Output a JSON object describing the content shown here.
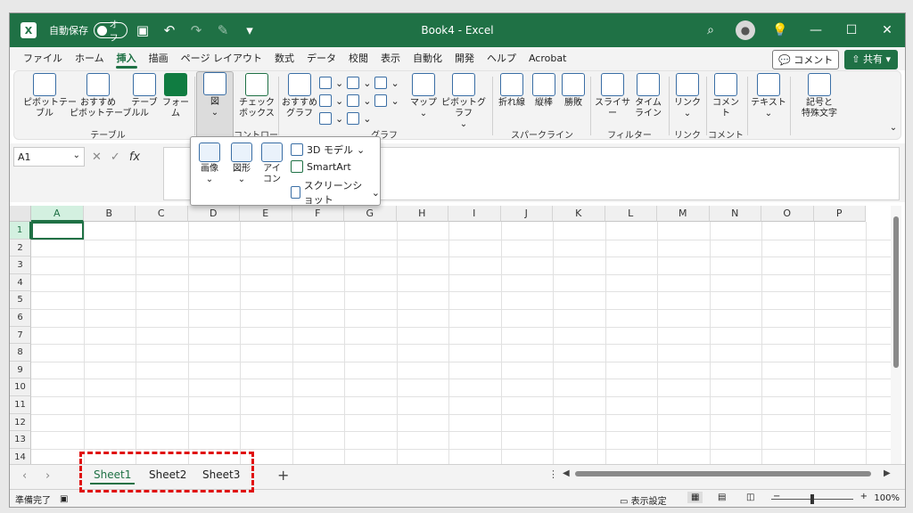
{
  "titlebar": {
    "autosave_label": "自動保存",
    "autosave_state": "オフ",
    "doc_title": "Book4 - Excel"
  },
  "tabs": [
    "ファイル",
    "ホーム",
    "挿入",
    "描画",
    "ページ レイアウト",
    "数式",
    "データ",
    "校閲",
    "表示",
    "自動化",
    "開発",
    "ヘルプ",
    "Acrobat"
  ],
  "active_tab": "挿入",
  "actions": {
    "comment": "コメント",
    "share": "共有"
  },
  "ribbon": {
    "pivot_table": "ピボットテー\nブル",
    "recommended_pivot": "おすすめ\nピボットテーブル",
    "table": "テーブル",
    "forms": "フォー\nム",
    "figure": "図",
    "checkbox": "チェック\nボックス",
    "recommended_charts": "おすすめ\nグラフ",
    "maps": "マップ",
    "pivot_chart": "ピボットグラフ",
    "line_spark": "折れ線",
    "column_spark": "縦棒",
    "winloss_spark": "勝敗",
    "slicer": "スライサー",
    "timeline": "タイム\nライン",
    "link": "リンク",
    "comment": "コメント",
    "text": "テキスト",
    "symbols": "記号と\n特殊文字",
    "groups": {
      "tables": "テーブル",
      "controls": "コントロール",
      "charts": "グラフ",
      "sparklines": "スパークライン",
      "filters": "フィルター",
      "links": "リンク",
      "comments": "コメント"
    }
  },
  "gallery": {
    "image": "画像",
    "shapes": "図形",
    "icons": "アイ\nコン",
    "model3d": "3D モデル",
    "smartart": "SmartArt",
    "screenshot": "スクリーンショット"
  },
  "namebox": "A1",
  "columns": [
    "A",
    "B",
    "C",
    "D",
    "E",
    "F",
    "G",
    "H",
    "I",
    "J",
    "K",
    "L",
    "M",
    "N",
    "O",
    "P"
  ],
  "rows": [
    "1",
    "2",
    "3",
    "4",
    "5",
    "6",
    "7",
    "8",
    "9",
    "10",
    "11",
    "12",
    "13",
    "14"
  ],
  "sheets": [
    "Sheet1",
    "Sheet2",
    "Sheet3"
  ],
  "status": {
    "ready": "準備完了",
    "display_settings": "表示設定",
    "zoom": "100%"
  },
  "colors": {
    "brand": "#1f7145",
    "highlight": "#e01010"
  }
}
